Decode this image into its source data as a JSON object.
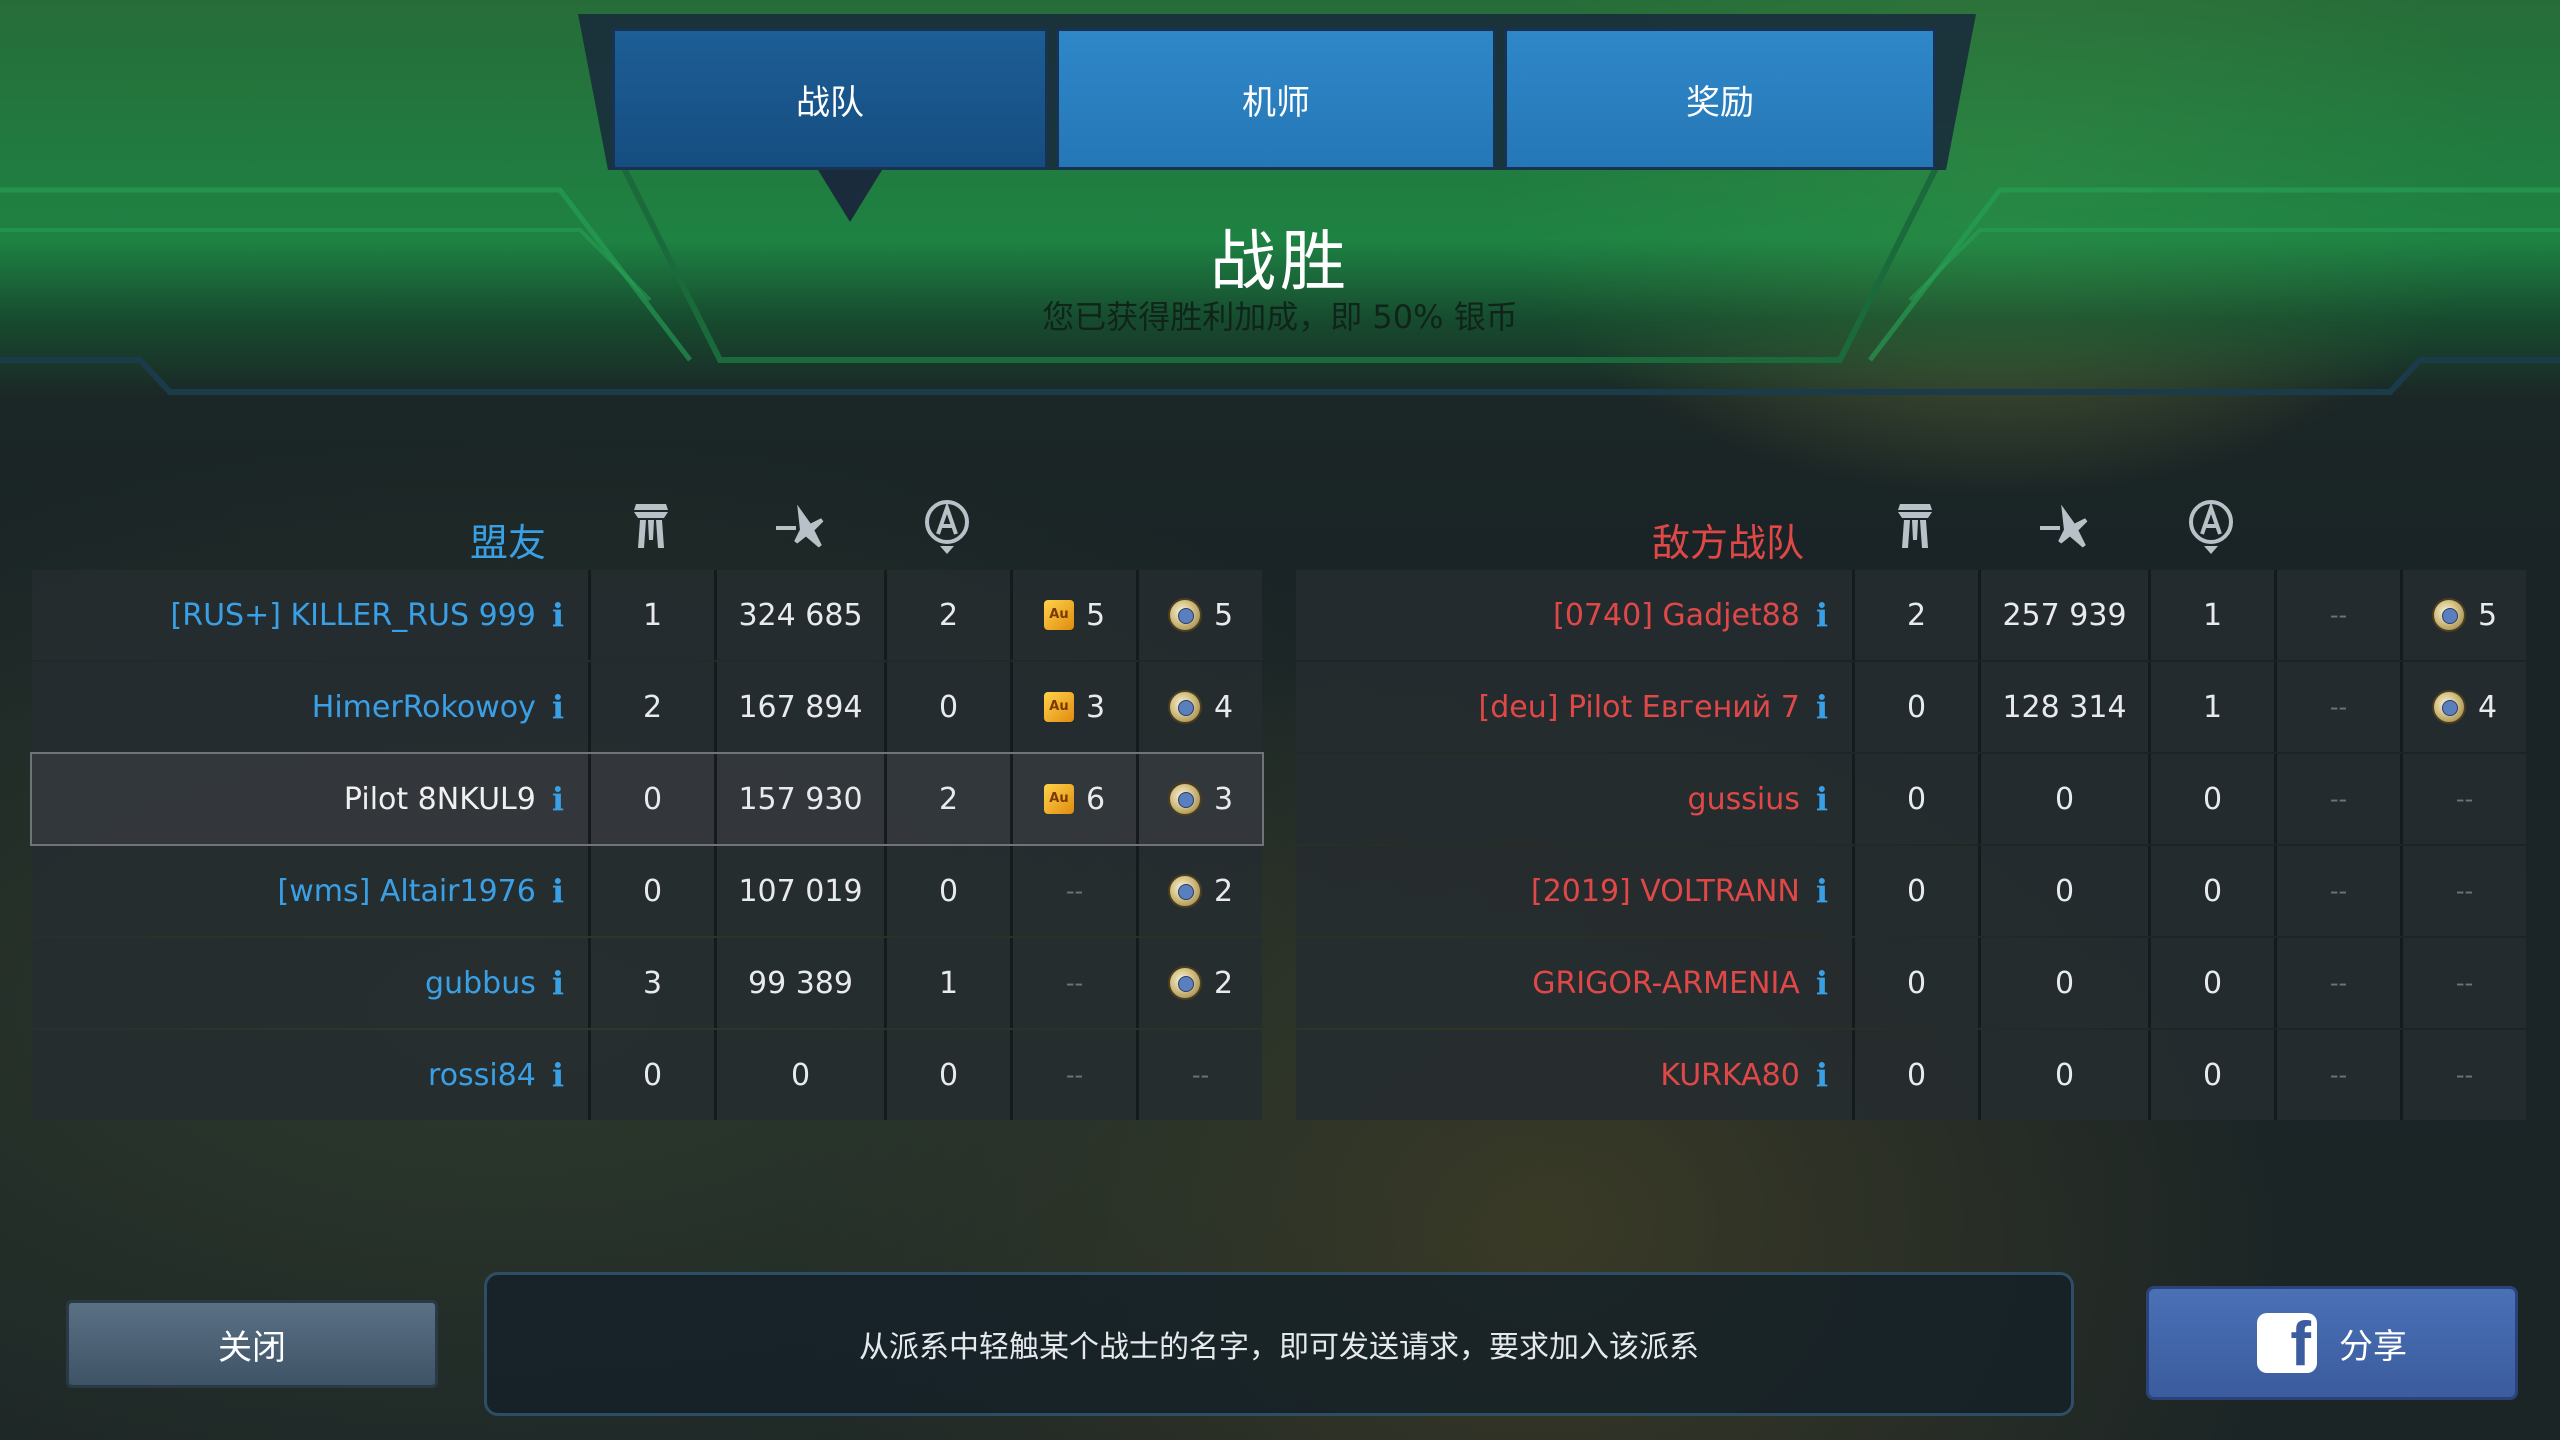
{
  "tabs": [
    {
      "label": "战队",
      "active": true
    },
    {
      "label": "机师",
      "active": false
    },
    {
      "label": "奖励",
      "active": false
    }
  ],
  "result": {
    "title": "战胜",
    "subtitle": "您已获得胜利加成，即 50% 银币"
  },
  "columns_icons": [
    "kills-icon",
    "damage-icon",
    "beacon-icon"
  ],
  "allies": {
    "title": "盟友",
    "rows": [
      {
        "name": "[RUS+] KILLER_RUS 999",
        "kills": "1",
        "damage": "324 685",
        "beacons": "2",
        "gold": "5",
        "silver": "5",
        "self": false
      },
      {
        "name": "HimerRokowoy",
        "kills": "2",
        "damage": "167 894",
        "beacons": "0",
        "gold": "3",
        "silver": "4",
        "self": false
      },
      {
        "name": "Pilot 8NKUL9",
        "kills": "0",
        "damage": "157 930",
        "beacons": "2",
        "gold": "6",
        "silver": "3",
        "self": true
      },
      {
        "name": "[wms] Altair1976",
        "kills": "0",
        "damage": "107 019",
        "beacons": "0",
        "gold": "--",
        "silver": "2",
        "self": false
      },
      {
        "name": "gubbus",
        "kills": "3",
        "damage": "99 389",
        "beacons": "1",
        "gold": "--",
        "silver": "2",
        "self": false
      },
      {
        "name": "rossi84",
        "kills": "0",
        "damage": "0",
        "beacons": "0",
        "gold": "--",
        "silver": "--",
        "self": false
      }
    ]
  },
  "enemies": {
    "title": "敌方战队",
    "rows": [
      {
        "name": "[0740] Gadjet88",
        "kills": "2",
        "damage": "257 939",
        "beacons": "1",
        "gold": "--",
        "silver": "5"
      },
      {
        "name": "[deu] Pilot Евгений 7",
        "kills": "0",
        "damage": "128 314",
        "beacons": "1",
        "gold": "--",
        "silver": "4"
      },
      {
        "name": "gussius",
        "kills": "0",
        "damage": "0",
        "beacons": "0",
        "gold": "--",
        "silver": "--"
      },
      {
        "name": "[2019] VOLTRANN",
        "kills": "0",
        "damage": "0",
        "beacons": "0",
        "gold": "--",
        "silver": "--"
      },
      {
        "name": "GRIGOR-ARMENIA",
        "kills": "0",
        "damage": "0",
        "beacons": "0",
        "gold": "--",
        "silver": "--"
      },
      {
        "name": "KURKA80",
        "kills": "0",
        "damage": "0",
        "beacons": "0",
        "gold": "--",
        "silver": "--"
      }
    ]
  },
  "gold_badge_text": "Au",
  "info_glyph": "i",
  "footer": {
    "close_label": "关闭",
    "hint": "从派系中轻触某个战士的名字，即可发送请求，要求加入该派系",
    "share_label": "分享",
    "share_icon": "facebook-icon",
    "share_icon_glyph": "f"
  },
  "colors": {
    "ally": "#3aa0e6",
    "enemy": "#e04848",
    "banner_green": "#1e8c46",
    "tab_blue": "#2577b6"
  }
}
